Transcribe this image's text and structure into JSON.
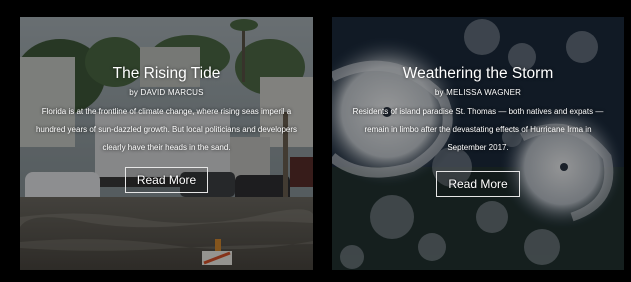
{
  "cards": [
    {
      "title": "The Rising Tide",
      "byline": "by DAVID MARCUS",
      "blurb": "Florida is at the frontline of climate change, where rising seas imperil a hundred years of sun-dazzled growth. But local politicians and developers clearly have their heads in the sand.",
      "button": "Read More",
      "background": "flooded-street-photo"
    },
    {
      "title": "Weathering the Storm",
      "byline": "by MELISSA WAGNER",
      "blurb": "Residents of island paradise St. Thomas — both natives and expats — remain in limbo after the devastating effects of Hurricane Irma in September 2017.",
      "button": "Read More",
      "background": "hurricane-satellite-photo"
    }
  ],
  "colors": {
    "page_background": "#000000",
    "text": "#ffffff",
    "button_border": "#e6e6e6"
  }
}
